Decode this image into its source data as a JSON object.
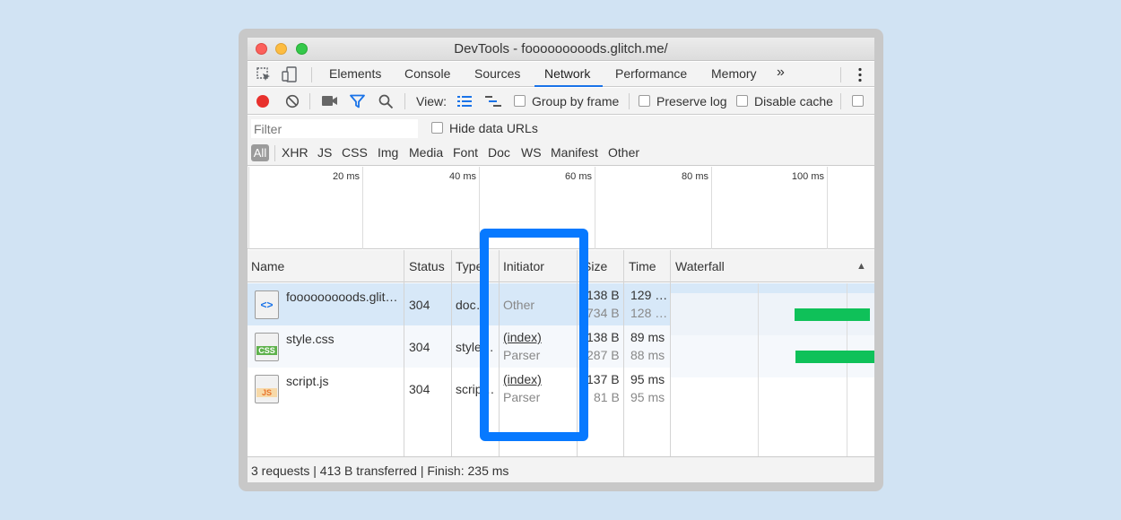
{
  "window": {
    "title": "DevTools - fooooooooods.glitch.me/"
  },
  "tabs": [
    "Elements",
    "Console",
    "Sources",
    "Network",
    "Performance",
    "Memory"
  ],
  "tabs_overflow": "»",
  "active_tab": "Network",
  "toolbar": {
    "view_label": "View:",
    "group_by_frame": "Group by frame",
    "preserve_log": "Preserve log",
    "disable_cache": "Disable cache"
  },
  "filter": {
    "placeholder": "Filter",
    "hide_data_urls": "Hide data URLs"
  },
  "types": [
    "All",
    "XHR",
    "JS",
    "CSS",
    "Img",
    "Media",
    "Font",
    "Doc",
    "WS",
    "Manifest",
    "Other"
  ],
  "overview_ticks": [
    "20 ms",
    "40 ms",
    "60 ms",
    "80 ms",
    "100 ms"
  ],
  "columns": {
    "name": "Name",
    "status": "Status",
    "type": "Type",
    "initiator": "Initiator",
    "size": "Size",
    "time": "Time",
    "waterfall": "Waterfall",
    "sort_icon": "▲"
  },
  "rows": [
    {
      "icon": "html-file-icon",
      "icon_text": "<>",
      "name": "fooooooooods.glit…",
      "status": "304",
      "type": "doc…",
      "initiator": "Other",
      "initiator_sub": "",
      "size": "138 B",
      "size_sub": "734 B",
      "time": "129 …",
      "time_sub": "128 …"
    },
    {
      "icon": "css-file-icon",
      "icon_text": "CSS",
      "name": "style.css",
      "status": "304",
      "type": "style…",
      "initiator": "(index)",
      "initiator_sub": "Parser",
      "size": "138 B",
      "size_sub": "287 B",
      "time": "89 ms",
      "time_sub": "88 ms"
    },
    {
      "icon": "js-file-icon",
      "icon_text": "JS",
      "name": "script.js",
      "status": "304",
      "type": "scrip…",
      "initiator": "(index)",
      "initiator_sub": "Parser",
      "size": "137 B",
      "size_sub": "81 B",
      "time": "95 ms",
      "time_sub": "95 ms"
    }
  ],
  "status_bar": "3 requests | 413 B transferred | Finish: 235 ms",
  "colors": {
    "highlight": "#0779ff",
    "waterfall_bar": "#0fc159",
    "active_tab_underline": "#1a73e8"
  }
}
